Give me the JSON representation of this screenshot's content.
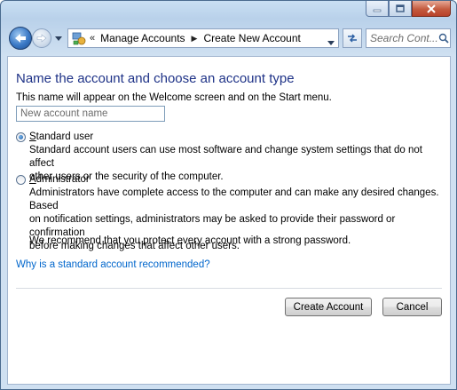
{
  "navigation": {
    "breadcrumb_overflow": "«",
    "breadcrumbs": [
      "Manage Accounts",
      "Create New Account"
    ],
    "search_placeholder": "Search Cont..."
  },
  "form": {
    "heading": "Name the account and choose an account type",
    "description": "This name will appear on the Welcome screen and on the Start menu.",
    "name_placeholder": "New account name",
    "name_value": "",
    "options": [
      {
        "label_underlined_char": "S",
        "label_rest": "tandard user",
        "selected": true,
        "description_lines": [
          "Standard account users can use most software and change system settings that do not affect",
          "other users or the security of the computer."
        ]
      },
      {
        "label_underlined_char": "A",
        "label_rest": "dministrator",
        "selected": false,
        "description_lines": [
          "Administrators have complete access to the computer and can make any desired changes. Based",
          "on notification settings, administrators may be asked to provide their password or confirmation",
          "before making changes that affect other users."
        ]
      }
    ],
    "recommendation": "We recommend that you protect every account with a strong password.",
    "help_link": "Why is a standard account recommended?"
  },
  "buttons": {
    "create": "Create Account",
    "cancel": "Cancel"
  },
  "colors": {
    "heading": "#1e3287",
    "link": "#0066cc",
    "frame": "#cfe0f1"
  }
}
